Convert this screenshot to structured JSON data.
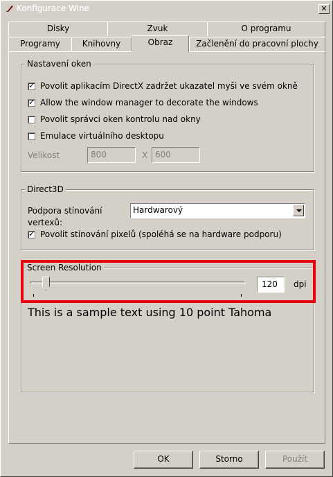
{
  "window": {
    "title": "Konfigurace Wine"
  },
  "tabs_row1": [
    "Disky",
    "Zvuk",
    "O programu"
  ],
  "tabs_row2": [
    "Programy",
    "Knihovny",
    "Obraz",
    "Začlenění do pracovní plochy"
  ],
  "active_tab": "Obraz",
  "window_settings": {
    "legend": "Nastavení oken",
    "options": [
      {
        "label": "Povolit aplikacím DirectX zadržet ukazatel myši ve svém okně",
        "checked": true
      },
      {
        "label": "Allow the window manager to decorate the windows",
        "checked": true
      },
      {
        "label": "Povolit správci oken kontrolu nad okny",
        "checked": false
      },
      {
        "label": "Emulace virtuálního desktopu",
        "checked": false
      }
    ],
    "size_label": "Velikost",
    "width": "800",
    "x_label": "X",
    "height": "600"
  },
  "direct3d": {
    "legend": "Direct3D",
    "vertex_label": "Podpora stínování vertexů:",
    "vertex_value": "Hardwarový",
    "pixel_shader": {
      "label": "Povolit stínování pixelů (spoléhá se na hardware podporu)",
      "checked": true
    }
  },
  "screen_resolution": {
    "legend": "Screen Resolution",
    "dpi_value": "120",
    "dpi_unit": "dpi",
    "sample_text": "This is a sample text using 10 point Tahoma"
  },
  "buttons": {
    "ok": "OK",
    "cancel": "Storno",
    "apply": "Použít"
  },
  "highlight_color": "#e8000d"
}
